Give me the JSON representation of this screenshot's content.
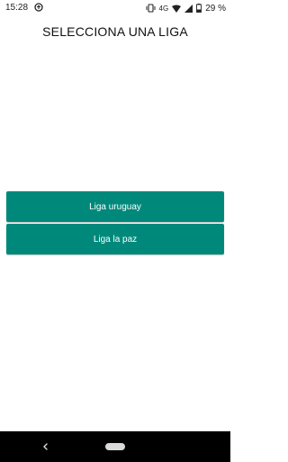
{
  "status_bar": {
    "time": "15:28",
    "network": "4G",
    "battery": "29 %",
    "icons": [
      "app-notification-icon",
      "vibrate-icon",
      "wifi-icon",
      "signal-icon",
      "battery-icon"
    ]
  },
  "screen": {
    "title": "SELECCIONA UNA LIGA"
  },
  "leagues": [
    {
      "label": "Liga uruguay"
    },
    {
      "label": "Liga la paz"
    }
  ],
  "nav_bar": {
    "icons": [
      "back-icon",
      "home-pill-icon"
    ]
  },
  "colors": {
    "button": "#00897b",
    "button_text": "#ffffff",
    "nav_bar": "#000000"
  }
}
